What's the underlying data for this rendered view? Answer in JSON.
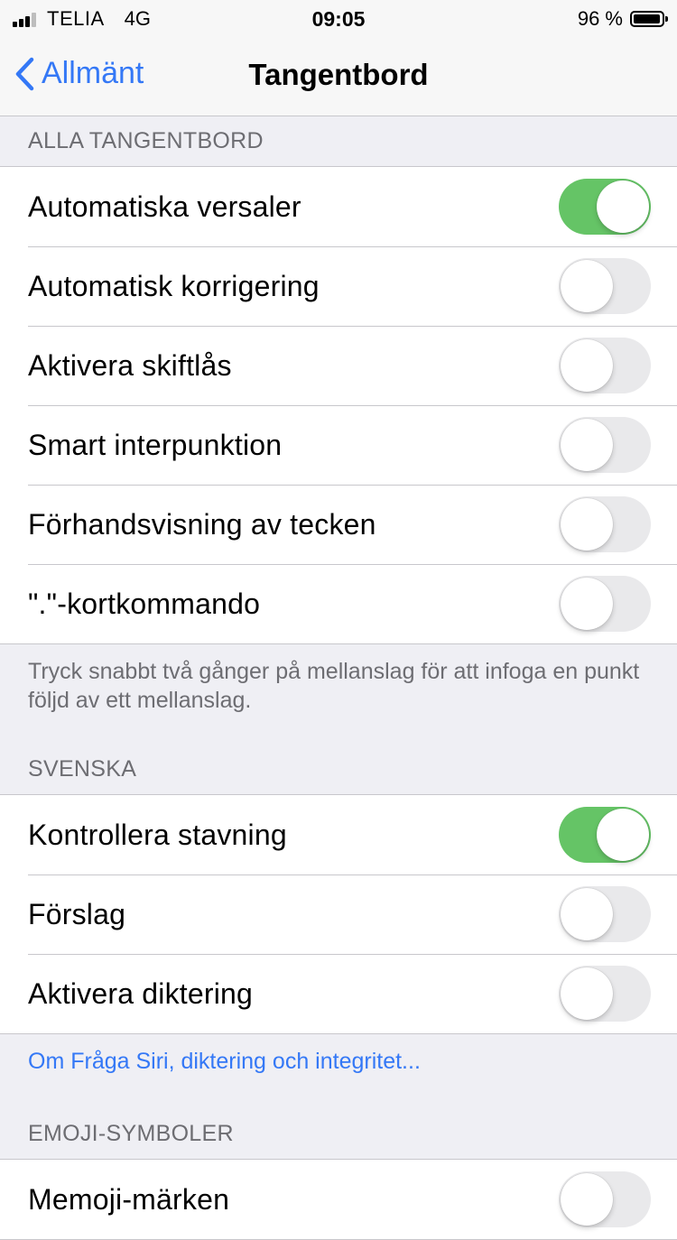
{
  "status_bar": {
    "carrier": "TELIA",
    "network": "4G",
    "time": "09:05",
    "battery": "96 %",
    "battery_level": 0.96
  },
  "nav": {
    "back_label": "Allmänt",
    "title": "Tangentbord"
  },
  "sections": {
    "all_keyboards": {
      "header": "ALLA TANGENTBORD",
      "items": [
        {
          "label": "Automatiska versaler",
          "on": true
        },
        {
          "label": "Automatisk korrigering",
          "on": false
        },
        {
          "label": "Aktivera skiftlås",
          "on": false
        },
        {
          "label": "Smart interpunktion",
          "on": false
        },
        {
          "label": "Förhandsvisning av tecken",
          "on": false
        },
        {
          "label": "\".\"-kortkommando",
          "on": false
        }
      ],
      "footer": "Tryck snabbt två gånger på mellanslag för att infoga en punkt följd av ett mellanslag."
    },
    "swedish": {
      "header": "SVENSKA",
      "items": [
        {
          "label": "Kontrollera stavning",
          "on": true
        },
        {
          "label": "Förslag",
          "on": false
        },
        {
          "label": "Aktivera diktering",
          "on": false
        }
      ],
      "footer_link": "Om Fråga Siri, diktering och integritet..."
    },
    "emoji": {
      "header": "EMOJI-SYMBOLER",
      "items": [
        {
          "label": "Memoji-märken",
          "on": false
        }
      ]
    }
  },
  "colors": {
    "accent": "#3478f6",
    "toggle_on": "#65c466",
    "toggle_off": "#e9e9eb"
  }
}
